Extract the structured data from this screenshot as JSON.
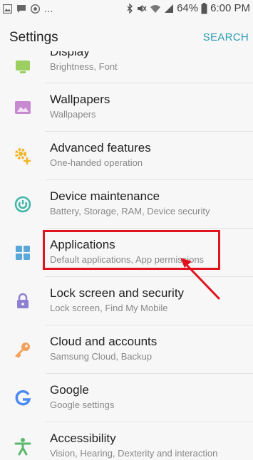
{
  "status_bar": {
    "more": "...",
    "battery_percent": "64%",
    "time": "6:00 PM"
  },
  "header": {
    "title": "Settings",
    "search_label": "SEARCH"
  },
  "items": [
    {
      "label": "Display",
      "sub": "Brightness, Font",
      "icon": "display-icon",
      "color": "#9ccf62"
    },
    {
      "label": "Wallpapers",
      "sub": "Wallpapers",
      "icon": "wallpaper-icon",
      "color": "#c78ad0"
    },
    {
      "label": "Advanced features",
      "sub": "One-handed operation",
      "icon": "advanced-features-icon",
      "color": "#f0b627"
    },
    {
      "label": "Device maintenance",
      "sub": "Battery, Storage, RAM, Device security",
      "icon": "device-maintenance-icon",
      "color": "#3fb6a7"
    },
    {
      "label": "Applications",
      "sub": "Default applications, App permissions",
      "icon": "applications-icon",
      "color": "#5aa7d9"
    },
    {
      "label": "Lock screen and security",
      "sub": "Lock screen, Find My Mobile",
      "icon": "lock-icon",
      "color": "#8f7fd1"
    },
    {
      "label": "Cloud and accounts",
      "sub": "Samsung Cloud, Backup",
      "icon": "key-icon",
      "color": "#f2a15c"
    },
    {
      "label": "Google",
      "sub": "Google settings",
      "icon": "google-icon",
      "color": "#4a8af4"
    },
    {
      "label": "Accessibility",
      "sub": "Vision, Hearing, Dexterity and interaction",
      "icon": "accessibility-icon",
      "color": "#5bb86b"
    }
  ],
  "annotation": {
    "highlight_color": "#e0141e"
  }
}
